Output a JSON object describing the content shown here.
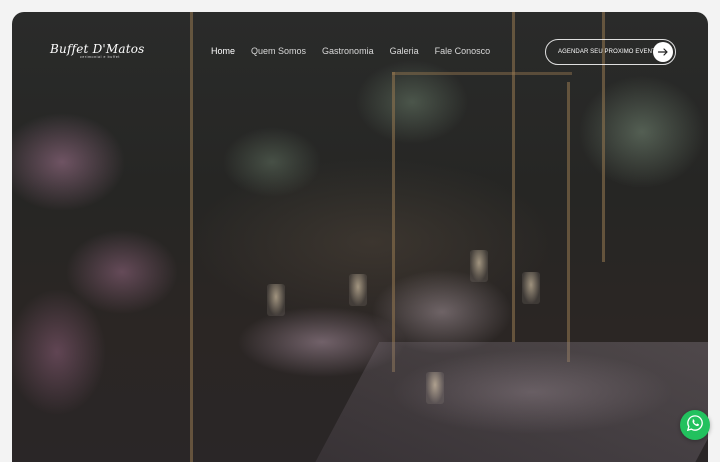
{
  "logo": {
    "name": "Buffet D'Matos",
    "tagline": "cerimonial e buffet"
  },
  "nav": {
    "items": [
      {
        "label": "Home",
        "active": true
      },
      {
        "label": "Quem Somos",
        "active": false
      },
      {
        "label": "Gastronomia",
        "active": false
      },
      {
        "label": "Galeria",
        "active": false
      },
      {
        "label": "Fale Conosco",
        "active": false
      }
    ]
  },
  "cta": {
    "label": "AGENDAR SEU PROXIMO EVENTO",
    "icon": "arrow-right-icon"
  },
  "floating": {
    "icon": "whatsapp-icon",
    "color": "#22c15e"
  },
  "hero": {
    "background_subject": "photo"
  }
}
